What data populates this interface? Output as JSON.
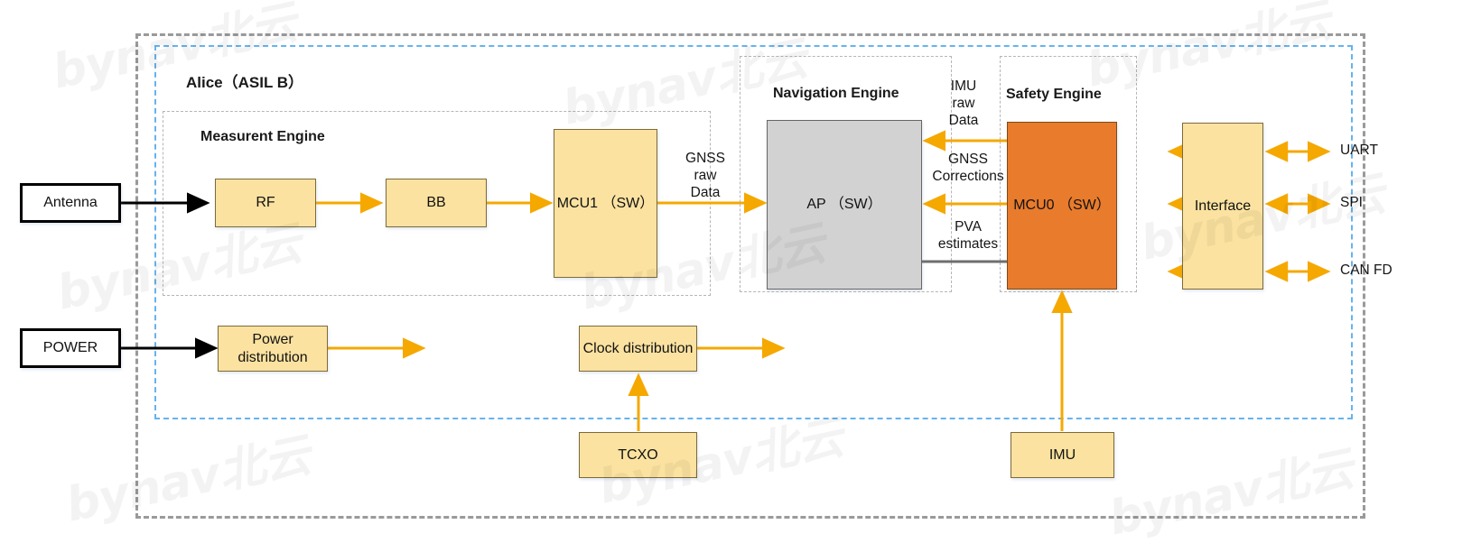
{
  "diagram": {
    "title": "Alice（ASIL B）",
    "colors": {
      "node_yellow": "#fbe2a0",
      "node_orange": "#e87b2c",
      "node_grey": "#d2d2d2",
      "arrow_yellow": "#f5a800",
      "arrow_black": "#000000",
      "arrow_grey": "#6e6e6e",
      "outer_boundary": "#9a9a9a",
      "inner_boundary": "#66b3ee",
      "group_boundary": "#b5b5b5"
    },
    "groups": [
      {
        "id": "measurement",
        "label": "Measurent Engine"
      },
      {
        "id": "navigation",
        "label": "Navigation Engine"
      },
      {
        "id": "safety",
        "label": "Safety Engine"
      }
    ],
    "nodes": [
      {
        "id": "antenna",
        "label": "Antenna",
        "style": "plain"
      },
      {
        "id": "power",
        "label": "POWER",
        "style": "plain"
      },
      {
        "id": "rf",
        "label": "RF",
        "style": "yellow"
      },
      {
        "id": "bb",
        "label": "BB",
        "style": "yellow"
      },
      {
        "id": "mcu1",
        "label": "MCU1\n（SW）",
        "style": "yellow"
      },
      {
        "id": "ap",
        "label": "AP\n（SW）",
        "style": "grey"
      },
      {
        "id": "mcu0",
        "label": "MCU0\n（SW）",
        "style": "orange"
      },
      {
        "id": "interface",
        "label": "Interface",
        "style": "yellow"
      },
      {
        "id": "powerdist",
        "label": "Power\ndistribution",
        "style": "yellow"
      },
      {
        "id": "clockdist",
        "label": "Clock\ndistribution",
        "style": "yellow"
      },
      {
        "id": "tcxo",
        "label": "TCXO",
        "style": "yellow"
      },
      {
        "id": "imu",
        "label": "IMU",
        "style": "yellow"
      }
    ],
    "edge_labels": [
      {
        "id": "gnss-raw-data",
        "text": "GNSS\nraw\nData"
      },
      {
        "id": "imu-raw-data",
        "text": "IMU\nraw\nData"
      },
      {
        "id": "gnss-corrections",
        "text": "GNSS\nCorrections"
      },
      {
        "id": "pva-estimates",
        "text": "PVA\nestimates"
      }
    ],
    "io_ports": [
      {
        "id": "uart",
        "label": "UART"
      },
      {
        "id": "spi",
        "label": "SPI"
      },
      {
        "id": "canfd",
        "label": "CAN FD"
      }
    ],
    "watermark": {
      "text": "bynav北云"
    }
  }
}
